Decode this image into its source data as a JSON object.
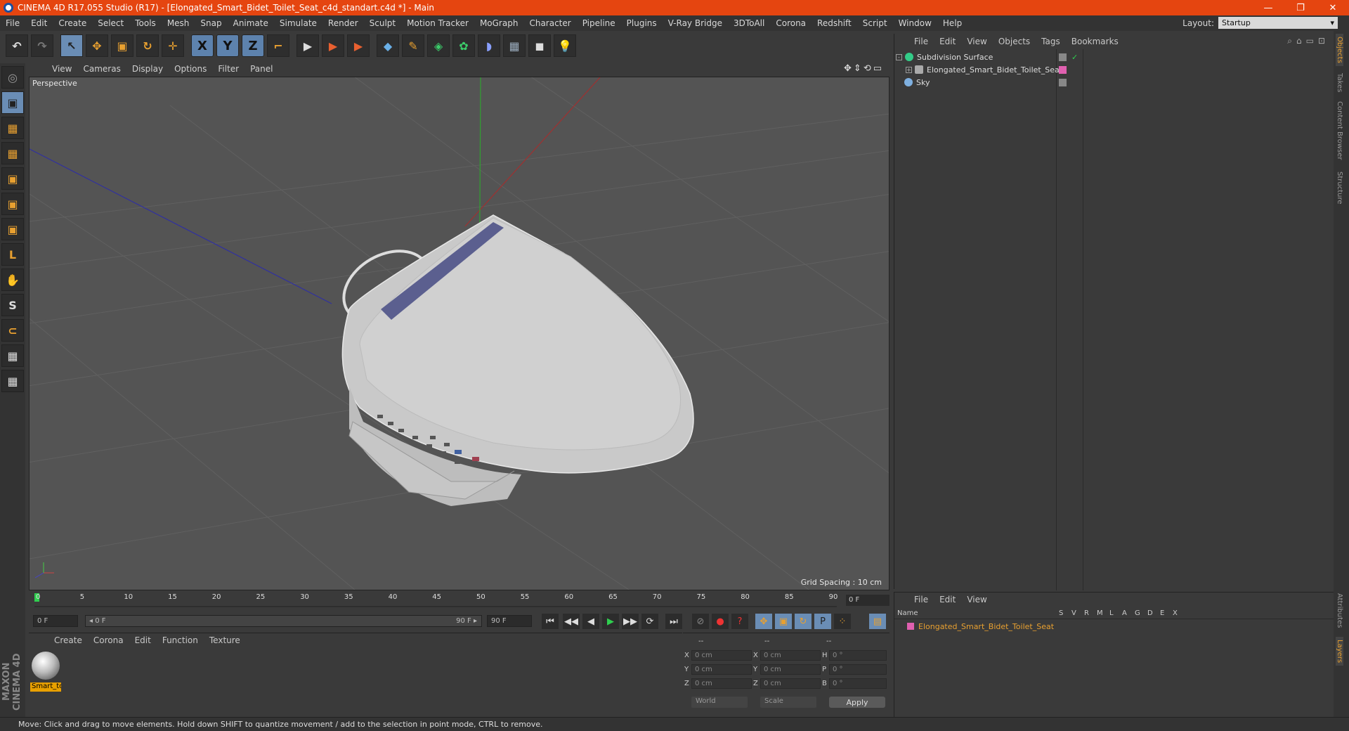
{
  "window": {
    "title": "CINEMA 4D R17.055 Studio (R17) - [Elongated_Smart_Bidet_Toilet_Seat_c4d_standart.c4d *] - Main",
    "controls": [
      "—",
      "❐",
      "✕"
    ]
  },
  "menu": [
    "File",
    "Edit",
    "Create",
    "Select",
    "Tools",
    "Mesh",
    "Snap",
    "Animate",
    "Simulate",
    "Render",
    "Sculpt",
    "Motion Tracker",
    "MoGraph",
    "Character",
    "Pipeline",
    "Plugins",
    "V-Ray Bridge",
    "3DToAll",
    "Corona",
    "Redshift",
    "Script",
    "Window",
    "Help"
  ],
  "layout": {
    "label": "Layout:",
    "value": "Startup"
  },
  "toolbar": {
    "undo": "↶",
    "redo": "↷",
    "select": "↖",
    "move": "✥",
    "scale": "▣",
    "rotate": "↻",
    "axis_tool": "✛",
    "x": "X",
    "y": "Y",
    "z": "Z",
    "coord": "⌐",
    "render1": "▶",
    "render2": "▶",
    "render3": "▶",
    "cube": "◆",
    "pen": "✎",
    "subdiv": "◈",
    "cloner": "✿",
    "deformer": "◗",
    "floor": "▦",
    "camera": "◼",
    "light": "💡"
  },
  "left_tools": [
    "◎",
    "▣",
    "▦",
    "▦",
    "▣",
    "▣",
    "▣",
    "L",
    "✋",
    "S",
    "⊂",
    "▦",
    "▦"
  ],
  "maxon": "MAXON CINEMA 4D",
  "viewport": {
    "menu": [
      "View",
      "Cameras",
      "Display",
      "Options",
      "Filter",
      "Panel"
    ],
    "nav_icons": "✥⇕⟲▭",
    "label": "Perspective",
    "grid_spacing": "Grid Spacing : 10 cm"
  },
  "timeline": {
    "ticks": [
      "0",
      "5",
      "10",
      "15",
      "20",
      "25",
      "30",
      "35",
      "40",
      "45",
      "50",
      "55",
      "60",
      "65",
      "70",
      "75",
      "80",
      "85",
      "90"
    ],
    "current": "0 F"
  },
  "transport": {
    "start": "0 F",
    "range_start": "◂ 0 F",
    "range_end": "90 F ▸",
    "end": "90 F",
    "buttons": [
      "⏮",
      "◀◀",
      "◀",
      "▶",
      "▶▶",
      "⟳",
      "⏭"
    ],
    "key_buttons": [
      "⊘",
      "●",
      "?",
      "✥",
      "▣",
      "↻",
      "P",
      "⁘",
      "▤"
    ]
  },
  "material_manager": {
    "menu": [
      "Create",
      "Corona",
      "Edit",
      "Function",
      "Texture"
    ],
    "material_label": "Smart_to"
  },
  "coord_manager": {
    "headers": [
      "--",
      "--",
      "--"
    ],
    "rows": [
      {
        "a": "X",
        "av": "0 cm",
        "b": "X",
        "bv": "0 cm",
        "c": "H",
        "cv": "0 °"
      },
      {
        "a": "Y",
        "av": "0 cm",
        "b": "Y",
        "bv": "0 cm",
        "c": "P",
        "cv": "0 °"
      },
      {
        "a": "Z",
        "av": "0 cm",
        "b": "Z",
        "bv": "0 cm",
        "c": "B",
        "cv": "0 °"
      }
    ],
    "world": "World",
    "scale": "Scale",
    "apply": "Apply"
  },
  "object_manager": {
    "menu": [
      "File",
      "Edit",
      "View",
      "Objects",
      "Tags",
      "Bookmarks"
    ],
    "tool_icons": "⌕⌂▭⊡",
    "objects": [
      {
        "name": "Subdivision Surface",
        "icon_color": "#33cc88"
      },
      {
        "name": "Elongated_Smart_Bidet_Toilet_Seat",
        "icon_color": "#aaaaaa"
      },
      {
        "name": "Sky",
        "icon_color": "#7fb0e0"
      }
    ]
  },
  "layer_manager": {
    "menu": [
      "File",
      "Edit",
      "View"
    ],
    "columns": [
      "Name",
      "S",
      "V",
      "R",
      "M",
      "L",
      "A",
      "G",
      "D",
      "E",
      "X"
    ],
    "layer": "Elongated_Smart_Bidet_Toilet_Seat",
    "layer_color": "#e060b0"
  },
  "right_tabs": [
    "Objects",
    "Takes",
    "Content Browser",
    "Structure",
    "Attributes",
    "Layers"
  ],
  "status": "Move: Click and drag to move elements. Hold down SHIFT to quantize movement / add to the selection in point mode, CTRL to remove."
}
